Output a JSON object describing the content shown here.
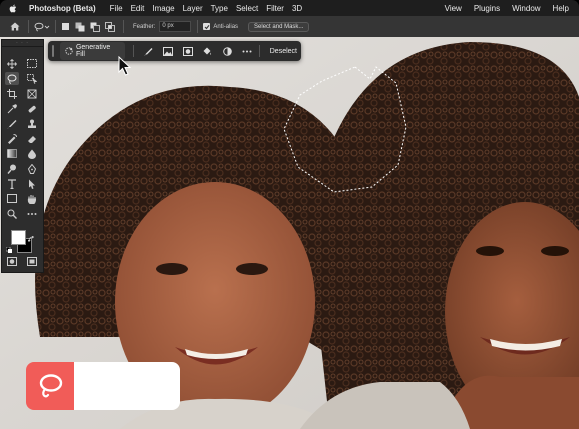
{
  "menubar": {
    "app_name": "Photoshop (Beta)",
    "menus": [
      "File",
      "Edit",
      "Image",
      "Layer",
      "Type",
      "Select",
      "Filter",
      "3D"
    ],
    "right_menus": [
      "View",
      "Plugins",
      "Window",
      "Help"
    ]
  },
  "options_bar": {
    "feather_label": "Feather:",
    "feather_value": "0 px",
    "anti_alias_label": "Anti-alias",
    "anti_alias_checked": true,
    "select_and_mask_label": "Select and Mask..."
  },
  "taskbar": {
    "generative_fill_label": "Generative Fill",
    "deselect_label": "Deselect",
    "icons": [
      "brush-icon",
      "image-icon",
      "mask-icon",
      "bucket-icon",
      "contrast-icon",
      "more-icon"
    ]
  },
  "toolbox": {
    "tools": [
      "move",
      "marquee",
      "lasso",
      "object-selection",
      "crop",
      "frame",
      "eyedropper",
      "spot-healing",
      "brush",
      "stamp",
      "history-brush",
      "eraser",
      "gradient",
      "blur",
      "dodge",
      "pen",
      "type",
      "path-selection",
      "shape",
      "hand",
      "zoom",
      "more"
    ],
    "selected": "lasso",
    "foreground_color": "#ffffff",
    "background_color": "#000000"
  },
  "colors": {
    "accent_red": "#f15c58",
    "ui_dark": "#2c2c2c"
  }
}
